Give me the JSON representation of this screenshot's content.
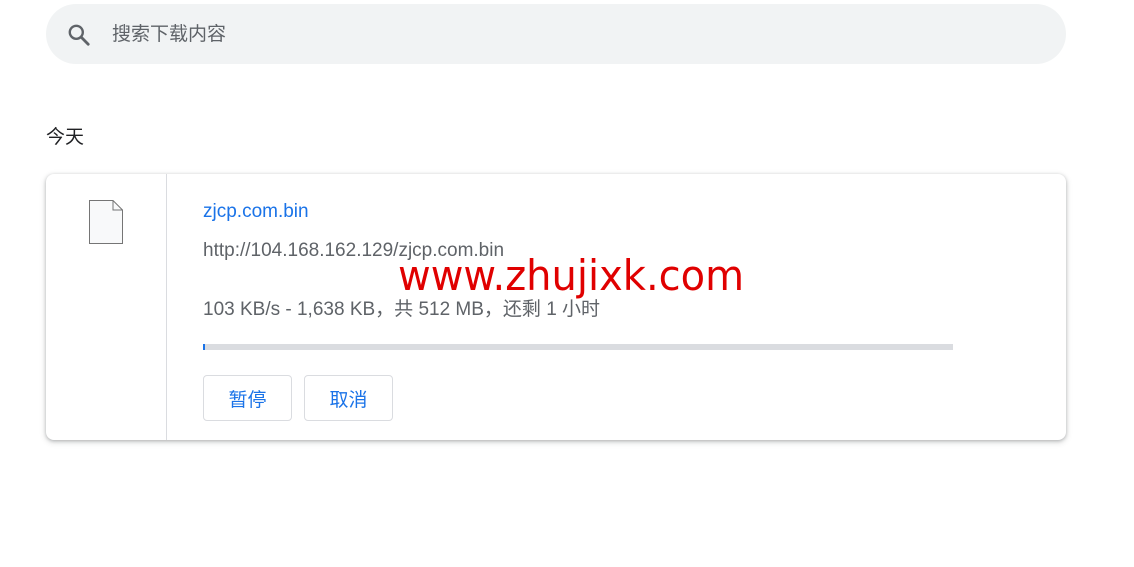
{
  "search": {
    "placeholder": "搜索下载内容",
    "value": ""
  },
  "section": {
    "heading": "今天"
  },
  "download": {
    "file_name": "zjcp.com.bin",
    "url": "http://104.168.162.129/zjcp.com.bin",
    "status": "103 KB/s - 1,638 KB，共 512 MB，还剩 1 小时",
    "progress_fraction": 0.003,
    "file_icon": "file-icon",
    "buttons": {
      "pause_label": "暂停",
      "cancel_label": "取消"
    }
  },
  "watermark": {
    "text": "www.zhujixk.com",
    "color": "#e00000"
  },
  "colors": {
    "accent": "#1a73e8",
    "search_background": "#f1f3f4",
    "secondary_text": "#5f6368",
    "progress_track": "#dadce0"
  }
}
